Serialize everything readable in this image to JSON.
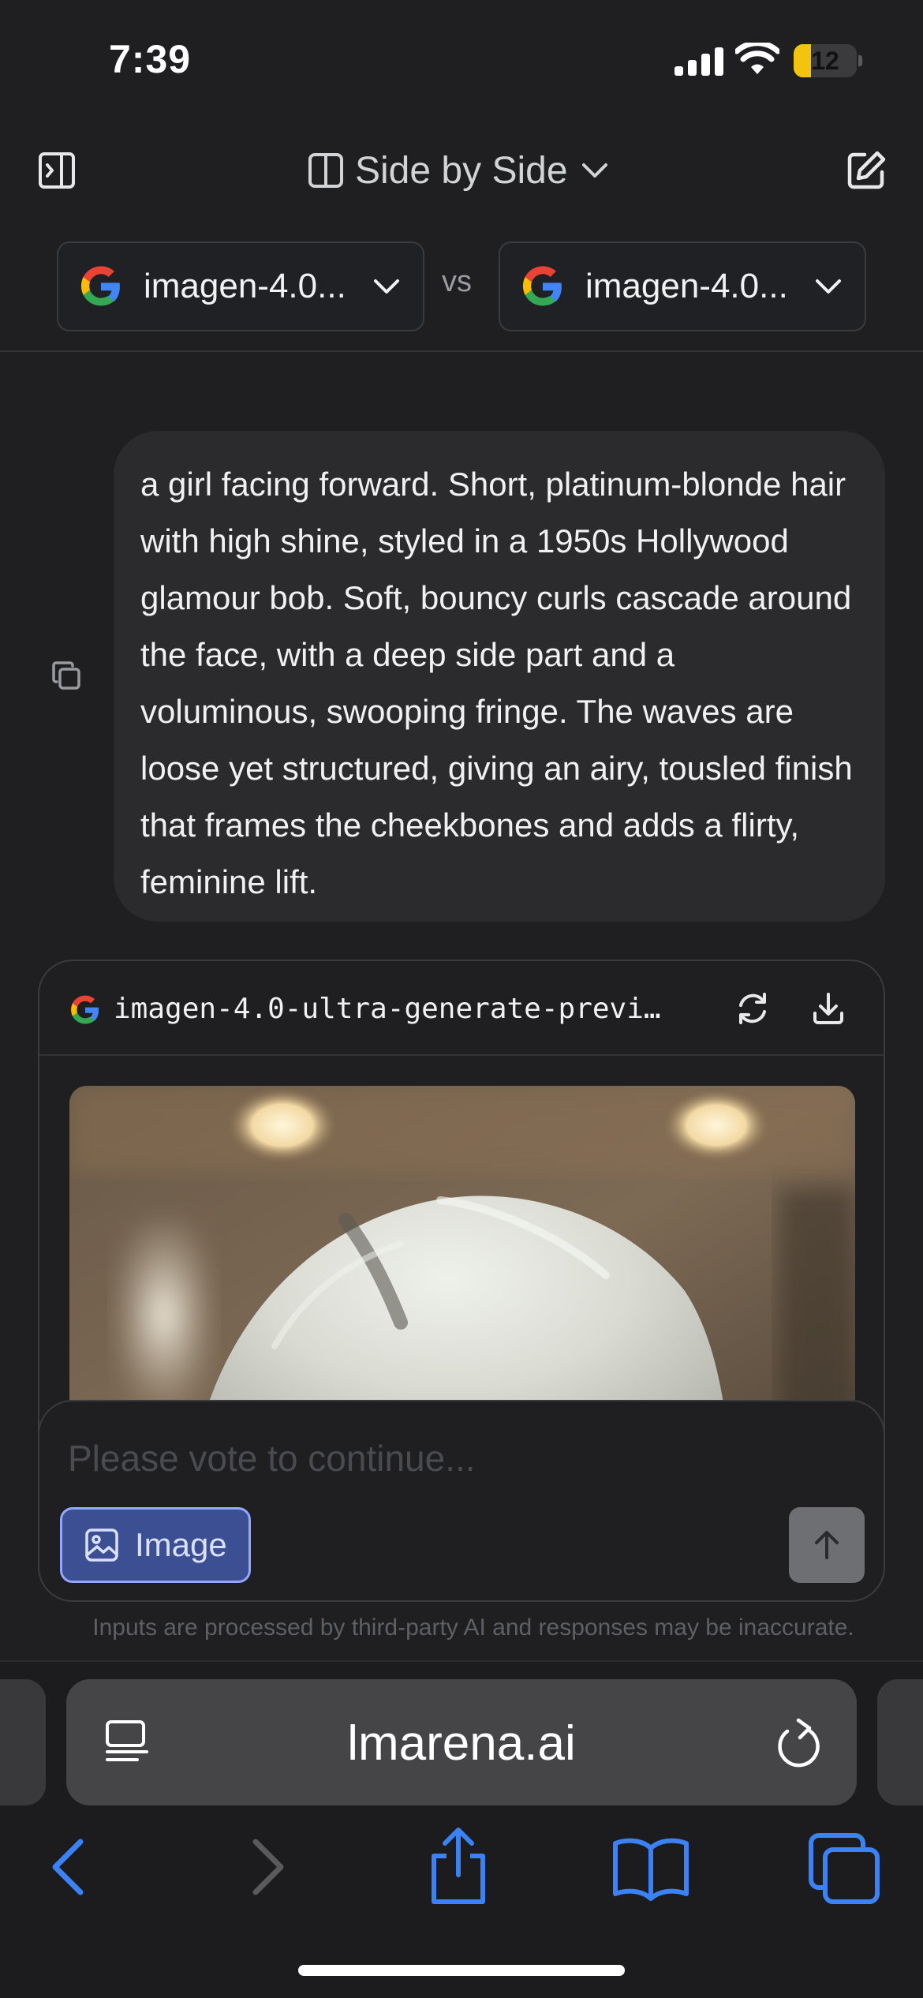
{
  "status_bar": {
    "time": "7:39",
    "battery_level": "12",
    "battery_color": "#f2c40f"
  },
  "toolbar": {
    "mode_label": "Side by Side",
    "icons": [
      "sidebar-toggle-icon",
      "columns-icon",
      "chevron-down-icon",
      "new-chat-icon"
    ]
  },
  "models": {
    "left_label": "imagen-4.0...",
    "vs_label": "vs",
    "right_label": "imagen-4.0..."
  },
  "prompt": {
    "text": "a girl facing forward. Short, platinum-blonde hair with high shine, styled in a 1950s Hollywood glamour bob. Soft, bouncy curls cascade around the face, with a deep side part and a voluminous, swooping fringe. The waves are loose yet structured, giving an airy, tousled finish that frames the cheekbones and adds a flirty, feminine lift."
  },
  "response": {
    "model_name": "imagen-4.0-ultra-generate-previ…",
    "image_subject": "platinum-blonde hair, blurred interior with ceiling lights"
  },
  "composer": {
    "placeholder": "Please vote to continue...",
    "image_button_label": "Image",
    "accent_color": "#3d4f93"
  },
  "disclaimer": "Inputs are processed by third-party AI and responses may be inaccurate.",
  "browser": {
    "url": "lmarena.ai",
    "accent_color": "#3b82f6"
  }
}
